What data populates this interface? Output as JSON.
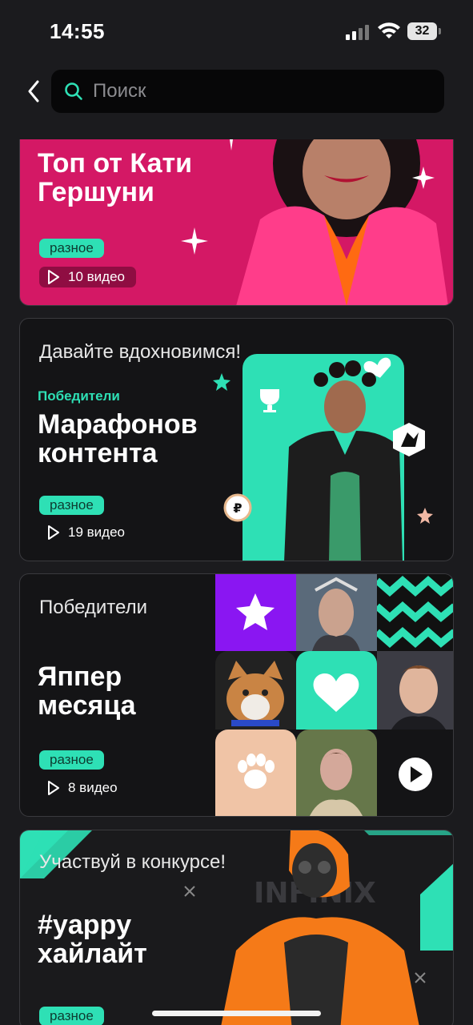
{
  "status_bar": {
    "time": "14:55",
    "battery": "32"
  },
  "search": {
    "placeholder": "Поиск"
  },
  "cards": [
    {
      "title_line1": "Топ от Кати",
      "title_line2": "Гершуни",
      "tag": "разное",
      "count": "10 видео"
    },
    {
      "kicker": "Давайте вдохновимся!",
      "subtitle": "Победители",
      "title_line1": "Марафонов",
      "title_line2": "контента",
      "tag": "разное",
      "count": "19 видео"
    },
    {
      "kicker": "Победители",
      "title_line1": "Яппер",
      "title_line2": "месяца",
      "tag": "разное",
      "count": "8 видео"
    },
    {
      "kicker": "Участвуй в конкурсе!",
      "title_line1": "#yappy",
      "title_line2": "хайлайт",
      "tag": "разное"
    }
  ],
  "colors": {
    "accent": "#2ee0b5",
    "pink": "#d41865",
    "background": "#1b1b1e"
  }
}
